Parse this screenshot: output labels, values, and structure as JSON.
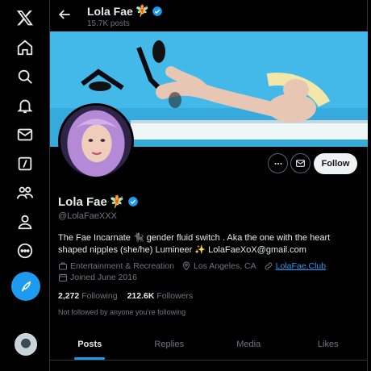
{
  "nav": {
    "items": [
      {
        "name": "x-logo-icon"
      },
      {
        "name": "home-icon"
      },
      {
        "name": "explore-icon"
      },
      {
        "name": "notifications-icon"
      },
      {
        "name": "messages-icon"
      },
      {
        "name": "grok-icon"
      },
      {
        "name": "communities-icon"
      },
      {
        "name": "profile-icon"
      },
      {
        "name": "more-icon"
      }
    ],
    "post_icon": "feather-plus-icon"
  },
  "header": {
    "name": "Lola Fae",
    "posts_count": "15.7K posts"
  },
  "profile": {
    "name": "Lola Fae",
    "handle": "@LolaFaeXXX",
    "bio": "The Fae Incarnate 🐈‍⬛ gender fluid switch . Aka the one with the heart shaped nipples (she/he) Lumineer ✨ LolaFaeXoX@gmail.com",
    "category": "Entertainment & Recreation",
    "location": "Los Angeles, CA",
    "website": "LolaFae.Club",
    "joined": "Joined June 2016",
    "following_count": "2,272",
    "following_label": "Following",
    "followers_count": "212.6K",
    "followers_label": "Followers",
    "not_followed_text": "Not followed by anyone you’re following"
  },
  "actions": {
    "follow_label": "Follow"
  },
  "tabs": [
    {
      "label": "Posts",
      "active": true
    },
    {
      "label": "Replies",
      "active": false
    },
    {
      "label": "Media",
      "active": false
    },
    {
      "label": "Likes",
      "active": false
    }
  ],
  "colors": {
    "accent": "#1d9bf0",
    "background": "#000000",
    "muted_text": "#71767b",
    "primary_text": "#e7e9ea"
  }
}
